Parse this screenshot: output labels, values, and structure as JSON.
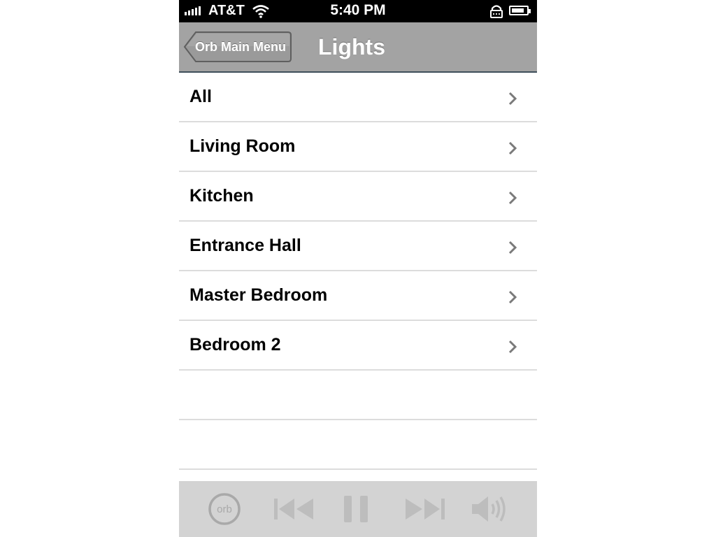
{
  "status_bar": {
    "carrier": "AT&T",
    "time": "5:40 PM",
    "signal_bars": 5,
    "battery_level": 0.85,
    "icons": [
      "signal-icon",
      "wifi-icon",
      "lock-icon",
      "battery-icon"
    ]
  },
  "nav": {
    "back_label": "Orb Main Menu",
    "title": "Lights"
  },
  "rooms": [
    {
      "label": "All"
    },
    {
      "label": "Living Room"
    },
    {
      "label": "Kitchen"
    },
    {
      "label": "Entrance Hall"
    },
    {
      "label": "Master Bedroom"
    },
    {
      "label": "Bedroom 2"
    }
  ],
  "toolbar": {
    "orb_logo_text": "orb",
    "icons": [
      "orb-logo-icon",
      "previous-track-icon",
      "pause-icon",
      "next-track-icon",
      "volume-icon"
    ]
  },
  "colors": {
    "nav_bar": "#a3a3a3",
    "toolbar": "#d3d3d3",
    "toolbar_icon": "#bdbdbd",
    "separator": "#dcdcdc"
  }
}
